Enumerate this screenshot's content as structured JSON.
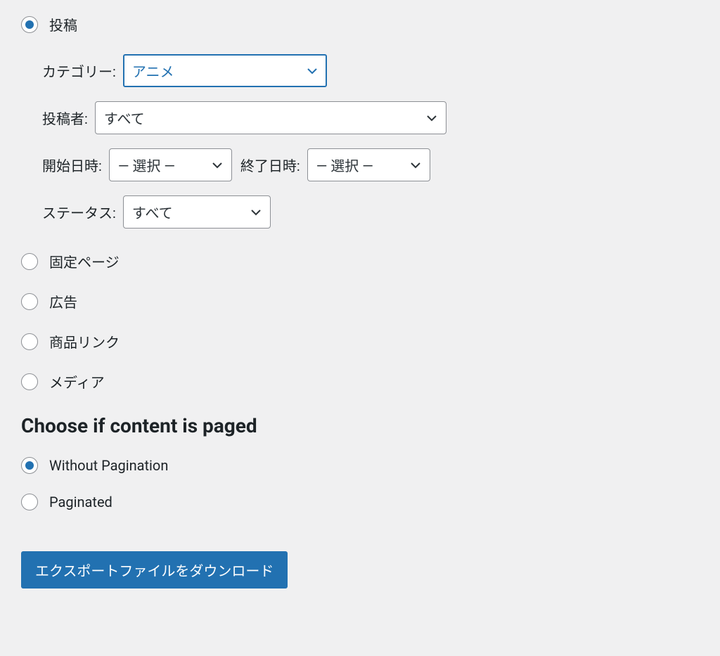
{
  "contentTypes": {
    "posts": "投稿",
    "pages": "固定ページ",
    "ads": "広告",
    "productLinks": "商品リンク",
    "media": "メディア"
  },
  "postFilters": {
    "categoryLabel": "カテゴリー:",
    "categoryValue": "アニメ",
    "authorLabel": "投稿者:",
    "authorValue": "すべて",
    "startDateLabel": "開始日時:",
    "startDateValue": "— 選択 —",
    "endDateLabel": "終了日時:",
    "endDateValue": "— 選択 —",
    "statusLabel": "ステータス:",
    "statusValue": "すべて"
  },
  "pagination": {
    "heading": "Choose if content is paged",
    "without": "Without Pagination",
    "paginated": "Paginated"
  },
  "button": {
    "download": "エクスポートファイルをダウンロード"
  }
}
